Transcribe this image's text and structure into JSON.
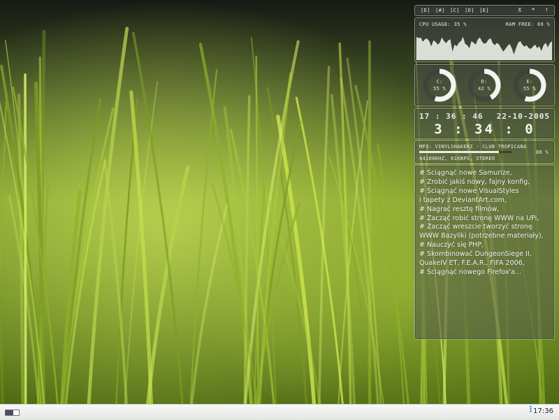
{
  "drivebar": {
    "drives": [
      "[D]",
      "[#]",
      "[C]",
      "[D]",
      "[E]"
    ],
    "controls": [
      "x",
      "*",
      "!"
    ]
  },
  "sysmon": {
    "cpu_label": "CPU USAGE: 35 %",
    "ram_label": "RAM FREE: 69 %",
    "cpu_percent": 35,
    "ram_free_percent": 69,
    "graph_values": [
      62,
      58,
      60,
      48,
      55,
      57,
      50,
      35,
      52,
      48,
      40,
      45,
      60,
      50,
      44,
      52,
      55,
      20,
      40,
      35,
      45,
      50,
      62,
      42,
      38,
      30,
      50,
      45,
      40,
      55,
      60,
      48,
      42,
      45,
      54,
      58,
      44,
      38,
      45,
      40,
      30,
      20,
      28,
      36,
      42,
      30,
      12,
      30,
      45,
      50,
      40,
      34,
      38,
      30,
      28,
      34,
      40,
      30,
      35,
      22,
      38,
      45,
      32,
      44,
      50
    ]
  },
  "disks": [
    {
      "label": "C:",
      "value": "55 %",
      "percent": 55
    },
    {
      "label": "D:",
      "value": "42 %",
      "percent": 42
    },
    {
      "label": "E:",
      "value": "55 %",
      "percent": 55
    }
  ],
  "clock": {
    "time": "17 : 36 : 46",
    "date": "22-10-2005",
    "uptime": "3 : 34 : 0"
  },
  "mp3": {
    "track": "MP3: VINYLSHAKERZ - CLUB TROPICANA",
    "progress_percent": 86,
    "progress_label": "86 %",
    "info": "44100KHZ, 61KBPS, STEREO"
  },
  "notes": [
    "# Ściągnąć nowe Samurize,",
    "# Zrobić jakiś nowy, fajny konfig,",
    "# Ściągnąć nowe VisualStyles",
    "i tapety z DeviantArt.com,",
    "# Nagrać resztę filmów,",
    "# Zacząć robić stronę WWW na UPi,",
    "# Zacząć wreszcie tworzyć stronę",
    "WWW Bazyliki (potrzebne materiały),",
    "# Nauczyć się PHP,",
    "# Skombinować DungeonSiege II,",
    "QuakeIV ET, F.E.A.R., FIFA 2006,",
    "# Ściągnąć nowego Firefox'a..."
  ],
  "taskbar": {
    "tray_dots": "⋮",
    "clock": "17:36"
  }
}
